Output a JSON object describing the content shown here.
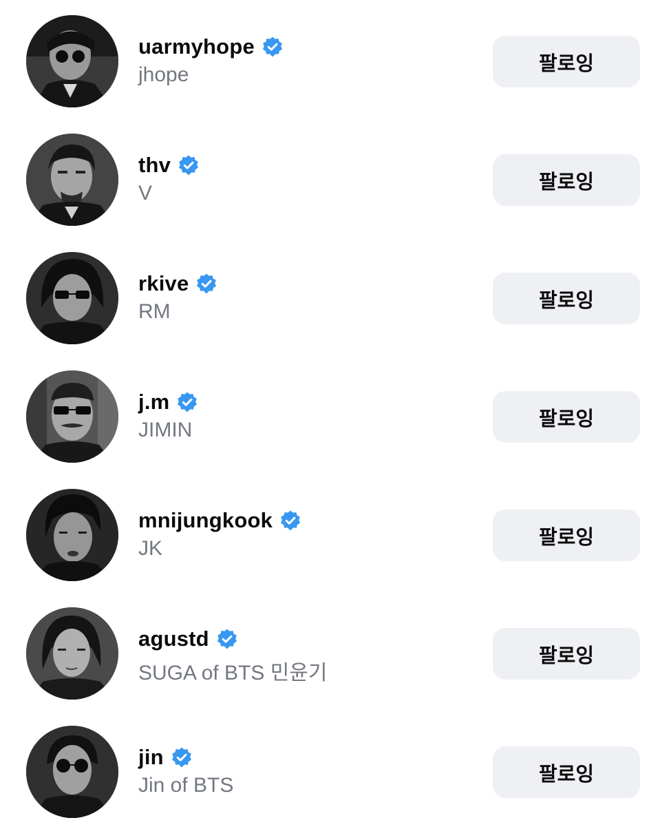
{
  "following_list": {
    "items": [
      {
        "username": "uarmyhope",
        "full_name": "jhope",
        "verified": true,
        "button_label": "팔로잉"
      },
      {
        "username": "thv",
        "full_name": "V",
        "verified": true,
        "button_label": "팔로잉"
      },
      {
        "username": "rkive",
        "full_name": "RM",
        "verified": true,
        "button_label": "팔로잉"
      },
      {
        "username": "j.m",
        "full_name": "JIMIN",
        "verified": true,
        "button_label": "팔로잉"
      },
      {
        "username": "mnijungkook",
        "full_name": "JK",
        "verified": true,
        "button_label": "팔로잉"
      },
      {
        "username": "agustd",
        "full_name": "SUGA of BTS 민윤기",
        "verified": true,
        "button_label": "팔로잉"
      },
      {
        "username": "jin",
        "full_name": "Jin of BTS",
        "verified": true,
        "button_label": "팔로잉"
      }
    ]
  },
  "colors": {
    "background": "#ffffff",
    "username_text": "#0b0b0b",
    "fullname_text": "#737780",
    "verified_badge": "#3897f0",
    "button_background": "#eef0f3"
  },
  "icons": {
    "verified": "verified-badge-icon",
    "avatar": "profile-photo-grayscale"
  }
}
